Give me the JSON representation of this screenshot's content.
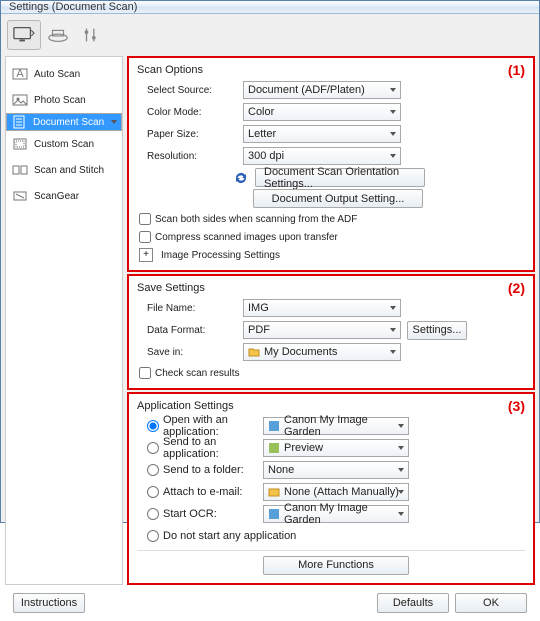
{
  "title": "Settings (Document Scan)",
  "sidebar": {
    "items": [
      {
        "label": "Auto Scan"
      },
      {
        "label": "Photo Scan"
      },
      {
        "label": "Document Scan"
      },
      {
        "label": "Custom Scan"
      },
      {
        "label": "Scan and Stitch"
      },
      {
        "label": "ScanGear"
      }
    ]
  },
  "scanOptions": {
    "title": "Scan Options",
    "annot": "(1)",
    "selectSource": {
      "label": "Select Source:",
      "value": "Document (ADF/Platen)"
    },
    "colorMode": {
      "label": "Color Mode:",
      "value": "Color"
    },
    "paperSize": {
      "label": "Paper Size:",
      "value": "Letter"
    },
    "resolution": {
      "label": "Resolution:",
      "value": "300 dpi"
    },
    "orientationBtn": "Document Scan Orientation Settings...",
    "outputBtn": "Document Output Setting...",
    "scanBoth": "Scan both sides when scanning from the ADF",
    "compress": "Compress scanned images upon transfer",
    "imgProc": "Image Processing Settings"
  },
  "saveSettings": {
    "title": "Save Settings",
    "annot": "(2)",
    "fileName": {
      "label": "File Name:",
      "value": "IMG"
    },
    "dataFormat": {
      "label": "Data Format:",
      "value": "PDF"
    },
    "settingsBtn": "Settings...",
    "saveIn": {
      "label": "Save in:",
      "value": "My Documents"
    },
    "check": "Check scan results"
  },
  "appSettings": {
    "title": "Application Settings",
    "annot": "(3)",
    "openWith": {
      "label": "Open with an application:",
      "value": "Canon My Image Garden"
    },
    "sendApp": {
      "label": "Send to an application:",
      "value": "Preview"
    },
    "sendFolder": {
      "label": "Send to a folder:",
      "value": "None"
    },
    "attach": {
      "label": "Attach to e-mail:",
      "value": "None (Attach Manually)"
    },
    "ocr": {
      "label": "Start OCR:",
      "value": "Canon My Image Garden"
    },
    "noStart": "Do not start any application",
    "moreBtn": "More Functions"
  },
  "footer": {
    "instructions": "Instructions",
    "defaults": "Defaults",
    "ok": "OK"
  }
}
